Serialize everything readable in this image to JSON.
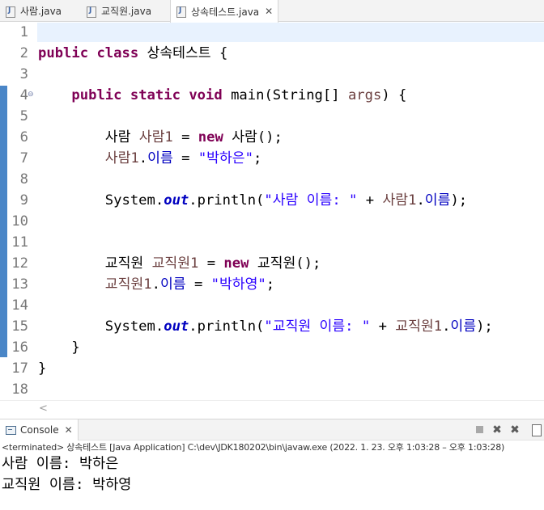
{
  "editor_tabs": [
    {
      "label": "사람.java",
      "active": false
    },
    {
      "label": "교직원.java",
      "active": false
    },
    {
      "label": "상속테스트.java",
      "active": true
    }
  ],
  "editor": {
    "lines": [
      {
        "no": "1",
        "tokens": []
      },
      {
        "no": "2",
        "tokens": [
          {
            "t": "kw",
            "s": "public"
          },
          {
            "t": "pl",
            "s": " "
          },
          {
            "t": "kw",
            "s": "class"
          },
          {
            "t": "pl",
            "s": " 상속테스트 {"
          }
        ]
      },
      {
        "no": "3",
        "tokens": []
      },
      {
        "no": "4",
        "fold": true,
        "tokens": [
          {
            "t": "pl",
            "s": "    "
          },
          {
            "t": "kw",
            "s": "public"
          },
          {
            "t": "pl",
            "s": " "
          },
          {
            "t": "kw",
            "s": "static"
          },
          {
            "t": "pl",
            "s": " "
          },
          {
            "t": "kw",
            "s": "void"
          },
          {
            "t": "pl",
            "s": " main(String[] "
          },
          {
            "t": "lv",
            "s": "args"
          },
          {
            "t": "pl",
            "s": ") {"
          }
        ]
      },
      {
        "no": "5",
        "tokens": []
      },
      {
        "no": "6",
        "tokens": [
          {
            "t": "pl",
            "s": "        사람 "
          },
          {
            "t": "lv",
            "s": "사람1"
          },
          {
            "t": "pl",
            "s": " = "
          },
          {
            "t": "kw",
            "s": "new"
          },
          {
            "t": "pl",
            "s": " 사람();"
          }
        ]
      },
      {
        "no": "7",
        "tokens": [
          {
            "t": "pl",
            "s": "        "
          },
          {
            "t": "lv",
            "s": "사람1"
          },
          {
            "t": "pl",
            "s": "."
          },
          {
            "t": "fld",
            "s": "이름"
          },
          {
            "t": "pl",
            "s": " = "
          },
          {
            "t": "str",
            "s": "\"박하은\""
          },
          {
            "t": "pl",
            "s": ";"
          }
        ]
      },
      {
        "no": "8",
        "tokens": []
      },
      {
        "no": "9",
        "tokens": [
          {
            "t": "pl",
            "s": "        System."
          },
          {
            "t": "sfld",
            "s": "out"
          },
          {
            "t": "pl",
            "s": ".println("
          },
          {
            "t": "str",
            "s": "\"사람 이름: \""
          },
          {
            "t": "pl",
            "s": " + "
          },
          {
            "t": "lv",
            "s": "사람1"
          },
          {
            "t": "pl",
            "s": "."
          },
          {
            "t": "fld",
            "s": "이름"
          },
          {
            "t": "pl",
            "s": ");"
          }
        ]
      },
      {
        "no": "10",
        "tokens": []
      },
      {
        "no": "11",
        "tokens": []
      },
      {
        "no": "12",
        "tokens": [
          {
            "t": "pl",
            "s": "        교직원 "
          },
          {
            "t": "lv",
            "s": "교직원1"
          },
          {
            "t": "pl",
            "s": " = "
          },
          {
            "t": "kw",
            "s": "new"
          },
          {
            "t": "pl",
            "s": " 교직원();"
          }
        ]
      },
      {
        "no": "13",
        "tokens": [
          {
            "t": "pl",
            "s": "        "
          },
          {
            "t": "lv",
            "s": "교직원1"
          },
          {
            "t": "pl",
            "s": "."
          },
          {
            "t": "fld",
            "s": "이름"
          },
          {
            "t": "pl",
            "s": " = "
          },
          {
            "t": "str",
            "s": "\"박하영\""
          },
          {
            "t": "pl",
            "s": ";"
          }
        ]
      },
      {
        "no": "14",
        "tokens": []
      },
      {
        "no": "15",
        "tokens": [
          {
            "t": "pl",
            "s": "        System."
          },
          {
            "t": "sfld",
            "s": "out"
          },
          {
            "t": "pl",
            "s": ".println("
          },
          {
            "t": "str",
            "s": "\"교직원 이름: \""
          },
          {
            "t": "pl",
            "s": " + "
          },
          {
            "t": "lv",
            "s": "교직원1"
          },
          {
            "t": "pl",
            "s": "."
          },
          {
            "t": "fld",
            "s": "이름"
          },
          {
            "t": "pl",
            "s": ");"
          }
        ]
      },
      {
        "no": "16",
        "tokens": [
          {
            "t": "pl",
            "s": "    }"
          }
        ]
      },
      {
        "no": "17",
        "tokens": [
          {
            "t": "pl",
            "s": "}"
          }
        ]
      },
      {
        "no": "18",
        "tokens": []
      }
    ],
    "scroll_left_arrow": "<"
  },
  "console": {
    "tab_label": "Console",
    "status": "<terminated> 상속테스트 [Java Application] C:\\dev\\JDK180202\\bin\\javaw.exe  (2022. 1. 23. 오후 1:03:28 – 오후 1:03:28)",
    "output": [
      "사람 이름: 박하은",
      "교직원 이름: 박하영"
    ]
  },
  "colors": {
    "keyword": "#7f0055",
    "string": "#2a00ff",
    "field": "#0000c0",
    "local_var": "#6a3e3e",
    "current_line": "#e8f2fe",
    "change_ruler": "#4a86c7"
  }
}
